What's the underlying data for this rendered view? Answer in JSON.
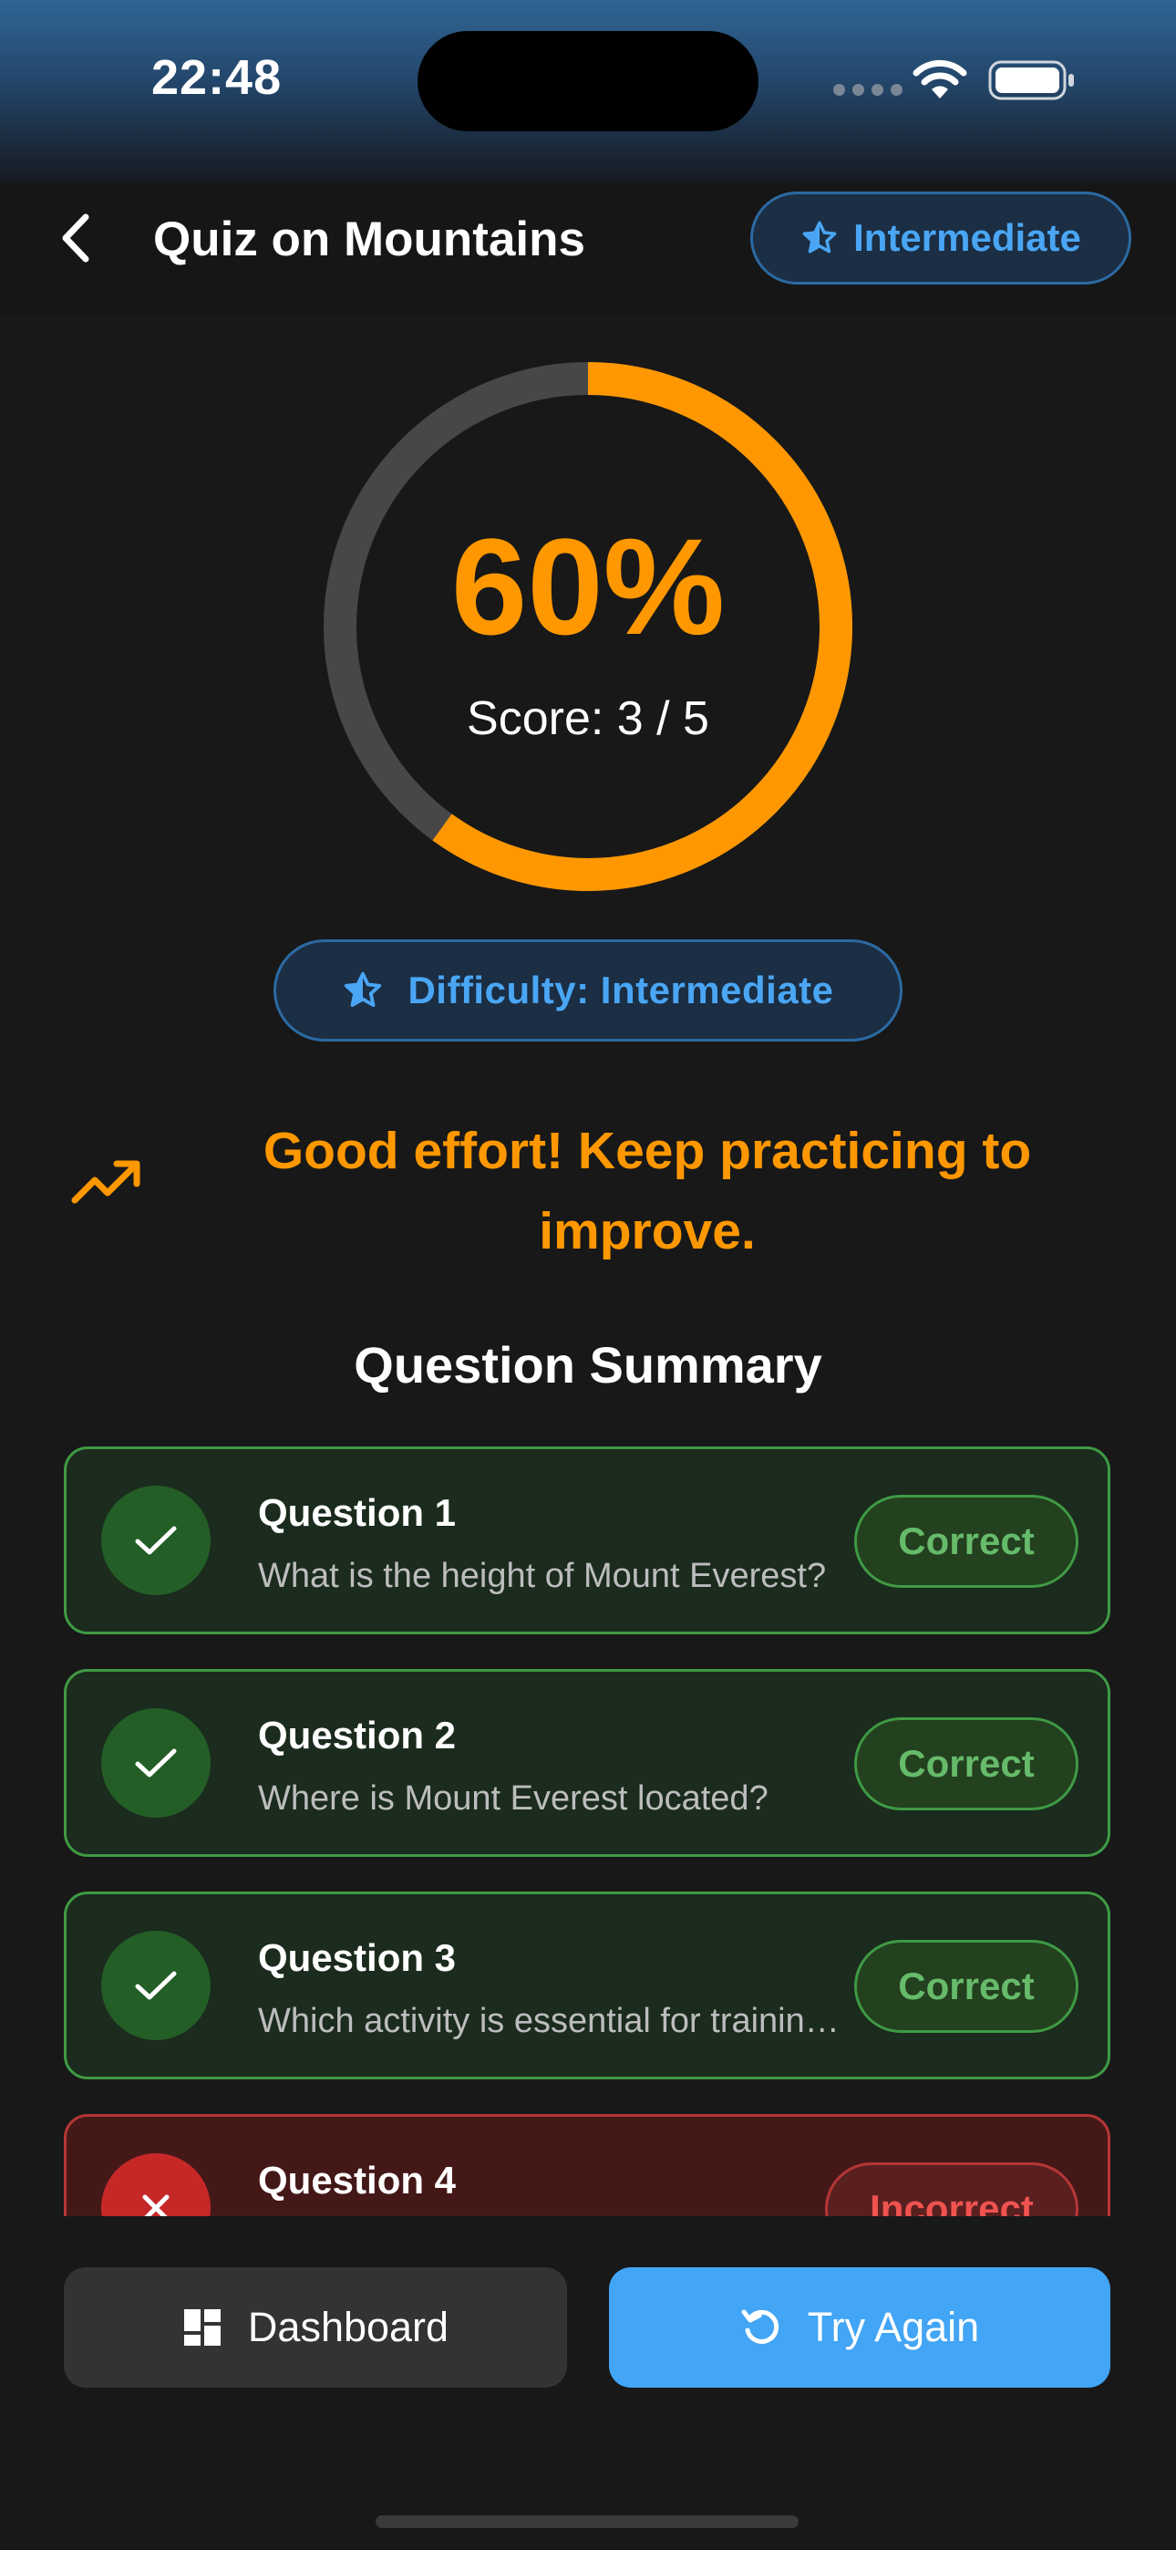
{
  "status_bar": {
    "time": "22:48"
  },
  "app_bar": {
    "title": "Quiz on Mountains",
    "level_chip": "Intermediate"
  },
  "result": {
    "percent_text": "60%",
    "score_text": "Score: 3 / 5",
    "score_fraction": 0.6,
    "difficulty": "Difficulty: Intermediate",
    "feedback": "Good effort! Keep practicing to improve."
  },
  "summary": {
    "title": "Question Summary",
    "questions": [
      {
        "title": "Question 1",
        "text": "What is the height of Mount Everest?",
        "status": "correct",
        "badge": "Correct"
      },
      {
        "title": "Question 2",
        "text": "Where is Mount Everest located?",
        "status": "correct",
        "badge": "Correct"
      },
      {
        "title": "Question 3",
        "text": "Which activity is essential for training?",
        "status": "correct",
        "badge": "Correct"
      },
      {
        "title": "Question 4",
        "text": "",
        "status": "incorrect",
        "badge": "Incorrect"
      }
    ]
  },
  "actions": {
    "dashboard": "Dashboard",
    "retry": "Try Again"
  },
  "icons": {
    "back": "chevron-left-icon",
    "level": "star-half-icon",
    "feedback": "trending-up-icon",
    "correct": "check-icon",
    "incorrect": "close-icon",
    "dashboard": "dashboard-grid-icon",
    "retry": "refresh-icon"
  },
  "colors": {
    "accent_orange": "#ff9800",
    "accent_blue": "#4aa6f4",
    "correct_green": "#66bb6a",
    "incorrect_red": "#ef5350",
    "retry_button": "#42a5f5"
  }
}
